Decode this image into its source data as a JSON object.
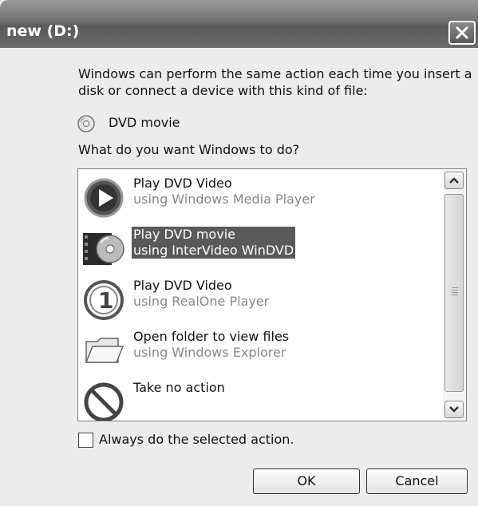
{
  "window": {
    "title": "new (D:)"
  },
  "description": "Windows can perform the same action each time you insert a disk or connect a device with this kind of file:",
  "media_type": {
    "label": "DVD movie",
    "icon": "dvd-disc-icon"
  },
  "question": "What do you want Windows to do?",
  "actions": [
    {
      "title": "Play DVD Video",
      "subtitle": "using Windows Media Player",
      "icon": "windows-media-player-icon",
      "selected": false
    },
    {
      "title": "Play DVD movie",
      "subtitle": "using InterVideo WinDVD",
      "icon": "windvd-icon",
      "selected": true
    },
    {
      "title": "Play DVD Video",
      "subtitle": "using RealOne Player",
      "icon": "realone-player-icon",
      "selected": false
    },
    {
      "title": "Open folder to view files",
      "subtitle": "using Windows Explorer",
      "icon": "folder-icon",
      "selected": false
    },
    {
      "title": "Take no action",
      "subtitle": "",
      "icon": "no-action-icon",
      "selected": false
    }
  ],
  "always_checkbox": {
    "label": "Always do the selected action.",
    "checked": false
  },
  "buttons": {
    "ok": "OK",
    "cancel": "Cancel"
  },
  "colors": {
    "selection": "#5a5a5a",
    "titlebar": "#6e6e6e"
  }
}
